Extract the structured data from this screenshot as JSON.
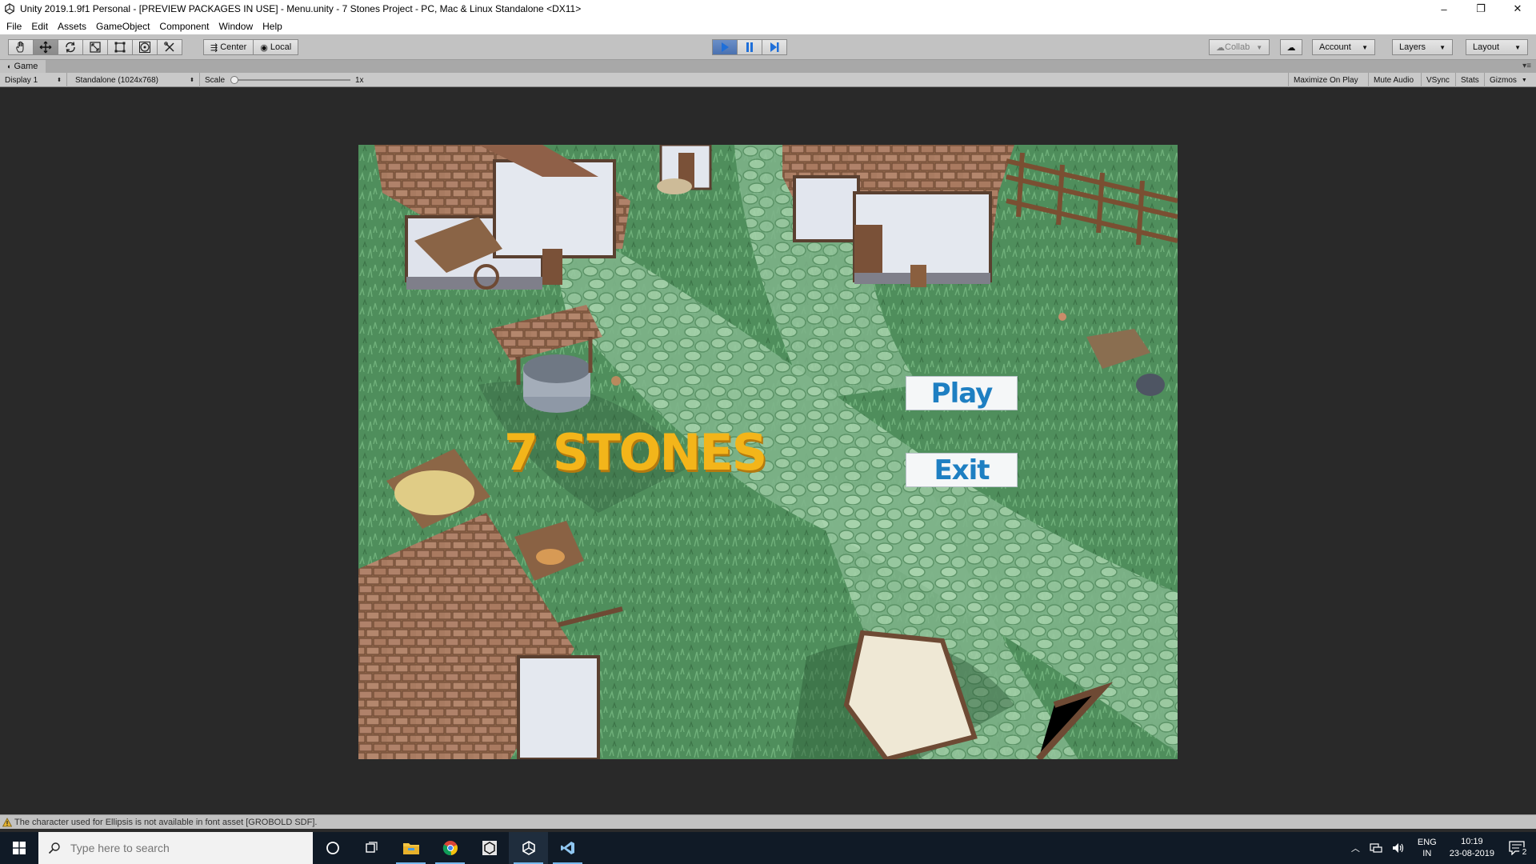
{
  "window": {
    "title": "Unity 2019.1.9f1 Personal - [PREVIEW PACKAGES IN USE] - Menu.unity - 7 Stones Project - PC, Mac & Linux Standalone <DX11>",
    "controls": {
      "minimize": "–",
      "restore": "❐",
      "close": "✕"
    }
  },
  "menubar": [
    "File",
    "Edit",
    "Assets",
    "GameObject",
    "Component",
    "Window",
    "Help"
  ],
  "toolbar": {
    "tools": [
      "hand-tool",
      "move-tool",
      "rotate-tool",
      "scale-tool",
      "rect-tool",
      "transform-tool",
      "custom-tool"
    ],
    "pivot": {
      "center_label": "Center",
      "local_label": "Local"
    },
    "collab_label": "Collab",
    "account_label": "Account",
    "layers_label": "Layers",
    "layout_label": "Layout",
    "play_color": "#4a71b0"
  },
  "game_tab": {
    "label": "Game"
  },
  "game_controls": {
    "display": "Display 1",
    "resolution": "Standalone (1024x768)",
    "scale_label": "Scale",
    "scale_value": "1x",
    "maximize_on_play": "Maximize On Play",
    "mute_audio": "Mute Audio",
    "vsync": "VSync",
    "stats": "Stats",
    "gizmos": "Gizmos"
  },
  "game": {
    "title": "7 STONES",
    "play_label": "Play",
    "exit_label": "Exit",
    "title_color": "#f3b51a",
    "button_text_color": "#1e7fc2"
  },
  "status": {
    "message": "The character used for Ellipsis is not available in font asset [GROBOLD SDF]."
  },
  "taskbar": {
    "search_placeholder": "Type here to search",
    "apps": [
      "cortana-icon",
      "task-view-icon",
      "file-explorer-icon",
      "chrome-icon",
      "unity-hub-icon",
      "unity-icon",
      "visual-studio-code-icon"
    ],
    "lang_line1": "ENG",
    "lang_line2": "IN",
    "time": "10:19",
    "date": "23-08-2019",
    "notifications": "2"
  }
}
